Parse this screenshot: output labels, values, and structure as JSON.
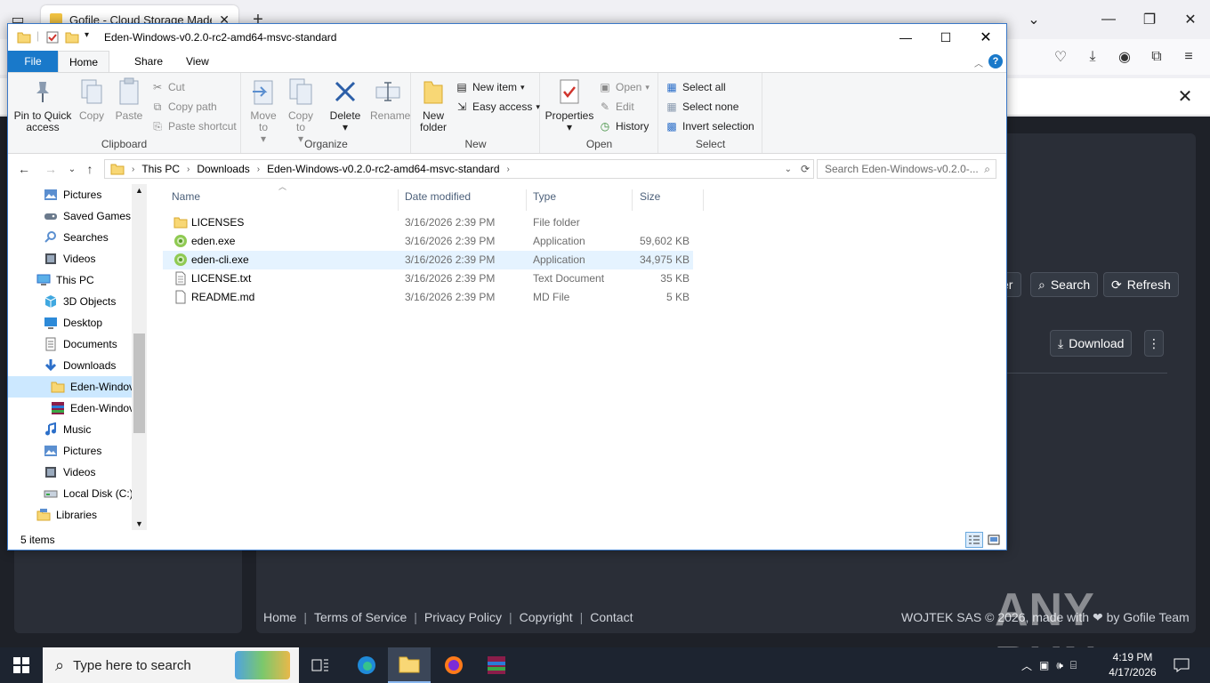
{
  "browser": {
    "tab_title": "Gofile - Cloud Storage Made Si",
    "new_tab_icon": "plus-icon"
  },
  "web": {
    "filter_partial": "er",
    "search_label": "Search",
    "refresh_label": "Refresh",
    "download_label": "Download",
    "footer_links": [
      "Home",
      "Terms of Service",
      "Privacy Policy",
      "Copyright",
      "Contact"
    ],
    "footer_right": "WOJTEK SAS © 2026, made with ❤ by Gofile Team",
    "watermark": "ANY RUN"
  },
  "explorer": {
    "title": "Eden-Windows-v0.2.0-rc2-amd64-msvc-standard",
    "ribbon_tabs": [
      "File",
      "Home",
      "Share",
      "View"
    ],
    "clipboard": {
      "pin_label": "Pin to Quick access",
      "copy_label": "Copy",
      "paste_label": "Paste",
      "cut_label": "Cut",
      "copy_path_label": "Copy path",
      "paste_shortcut_label": "Paste shortcut",
      "group_label": "Clipboard"
    },
    "organize": {
      "move_to_label": "Move to",
      "copy_to_label": "Copy to",
      "delete_label": "Delete",
      "rename_label": "Rename",
      "group_label": "Organize"
    },
    "new": {
      "new_folder_label": "New folder",
      "new_item_label": "New item",
      "easy_access_label": "Easy access",
      "group_label": "New"
    },
    "open": {
      "properties_label": "Properties",
      "open_label": "Open",
      "edit_label": "Edit",
      "history_label": "History",
      "group_label": "Open"
    },
    "select": {
      "select_all_label": "Select all",
      "select_none_label": "Select none",
      "invert_label": "Invert selection",
      "group_label": "Select"
    },
    "address": [
      "This PC",
      "Downloads",
      "Eden-Windows-v0.2.0-rc2-amd64-msvc-standard"
    ],
    "search_placeholder": "Search Eden-Windows-v0.2.0-...",
    "nav_tree": [
      {
        "label": "Pictures",
        "icon": "pictures-icon"
      },
      {
        "label": "Saved Games",
        "icon": "saved-games-icon"
      },
      {
        "label": "Searches",
        "icon": "searches-icon"
      },
      {
        "label": "Videos",
        "icon": "videos-icon"
      },
      {
        "label": "This PC",
        "icon": "computer-icon"
      },
      {
        "label": "3D Objects",
        "icon": "3d-objects-icon"
      },
      {
        "label": "Desktop",
        "icon": "desktop-icon"
      },
      {
        "label": "Documents",
        "icon": "documents-icon"
      },
      {
        "label": "Downloads",
        "icon": "downloads-icon"
      },
      {
        "label": "Eden-Windov",
        "icon": "folder-icon"
      },
      {
        "label": "Eden-Windov",
        "icon": "archive-icon"
      },
      {
        "label": "Music",
        "icon": "music-icon"
      },
      {
        "label": "Pictures",
        "icon": "pictures-icon"
      },
      {
        "label": "Videos",
        "icon": "videos-icon"
      },
      {
        "label": "Local Disk (C:)",
        "icon": "disk-icon"
      },
      {
        "label": "Libraries",
        "icon": "libraries-icon"
      }
    ],
    "columns": [
      "Name",
      "Date modified",
      "Type",
      "Size"
    ],
    "files": [
      {
        "name": "LICENSES",
        "date": "3/16/2026 2:39 PM",
        "type": "File folder",
        "size": "",
        "icon": "folder-icon"
      },
      {
        "name": "eden.exe",
        "date": "3/16/2026 2:39 PM",
        "type": "Application",
        "size": "59,602 KB",
        "icon": "app-icon"
      },
      {
        "name": "eden-cli.exe",
        "date": "3/16/2026 2:39 PM",
        "type": "Application",
        "size": "34,975 KB",
        "icon": "app-icon"
      },
      {
        "name": "LICENSE.txt",
        "date": "3/16/2026 2:39 PM",
        "type": "Text Document",
        "size": "35 KB",
        "icon": "text-file-icon"
      },
      {
        "name": "README.md",
        "date": "3/16/2026 2:39 PM",
        "type": "MD File",
        "size": "5 KB",
        "icon": "file-icon"
      }
    ],
    "status": "5 items"
  },
  "taskbar": {
    "search_placeholder": "Type here to search",
    "time": "4:19 PM",
    "date": "4/17/2026"
  },
  "colors": {
    "accent": "#1979ca",
    "web_bg": "#1e2128",
    "taskbar": "#1d2430"
  }
}
